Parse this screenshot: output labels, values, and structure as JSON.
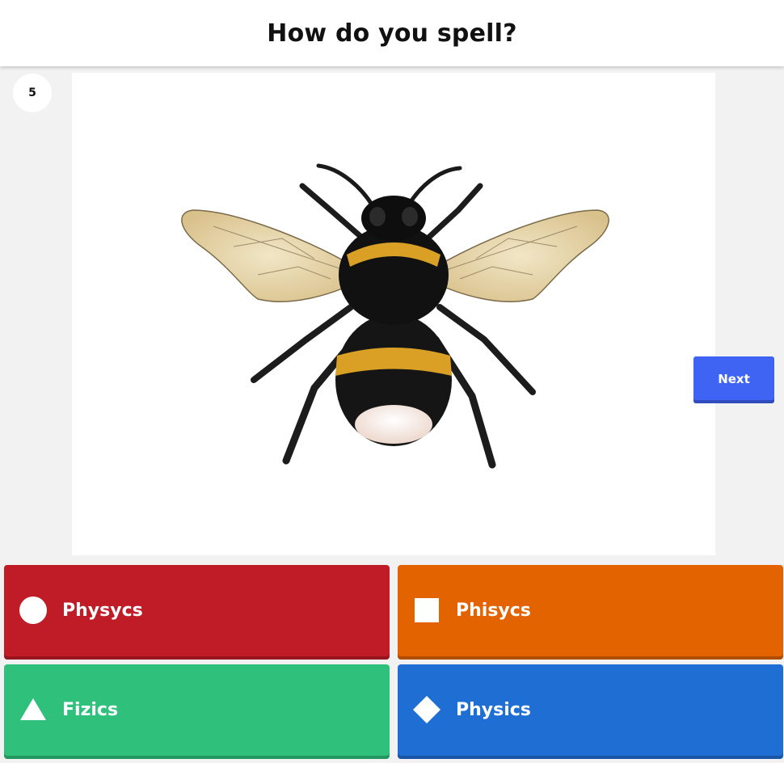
{
  "question": {
    "title": "How do you spell?",
    "number": "5",
    "image_icon": "bumblebee-illustration"
  },
  "controls": {
    "next_label": "Next"
  },
  "answers": [
    {
      "label": "Physycs",
      "shape": "circle-icon",
      "color": "#c01c28"
    },
    {
      "label": "Phisycs",
      "shape": "square-icon",
      "color": "#e26300"
    },
    {
      "label": "Fizics",
      "shape": "triangle-icon",
      "color": "#2fc07b"
    },
    {
      "label": "Physics",
      "shape": "diamond-icon",
      "color": "#1f6ed4"
    }
  ],
  "colors": {
    "background": "#f2f2f2",
    "next_button": "#3f63f3"
  }
}
